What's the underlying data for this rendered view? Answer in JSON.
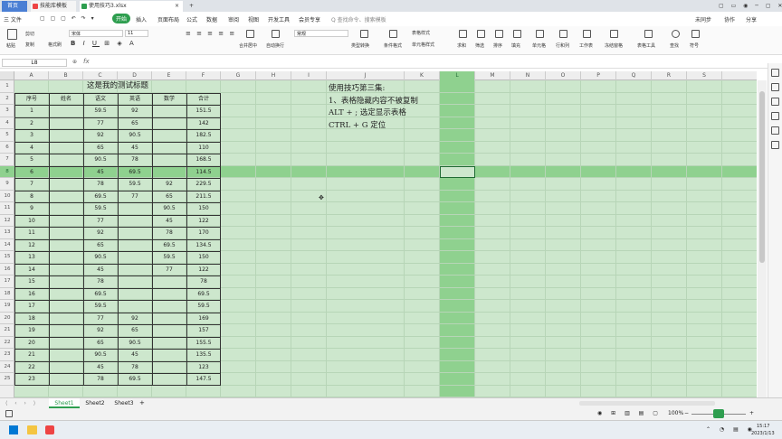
{
  "tabs": {
    "home": "首页",
    "t1": "技能库模板",
    "t2": "使用技巧3.xlsx",
    "add": "+"
  },
  "menu": {
    "file": "三 文件",
    "start": "开始",
    "items": [
      "插入",
      "页面布局",
      "公式",
      "数据",
      "审阅",
      "视图",
      "开发工具",
      "会员专享"
    ],
    "search": "Q 查找命令、搜索模板",
    "sync": "未同步",
    "collab": "协作",
    "share": "分享"
  },
  "ribbon": {
    "paste": "粘贴",
    "cut": "剪切",
    "copy": "复制",
    "format_painter": "格式刷",
    "font_name": "宋体",
    "font_size": "11",
    "merge": "合并居中",
    "wrap": "自动换行",
    "numfmt": "常规",
    "type_convert": "类型转换",
    "cond_fmt": "条件格式",
    "table_style": "表格样式",
    "cell_style": "单元格样式",
    "sum": "求和",
    "filter": "筛选",
    "sort": "排序",
    "fill": "填充",
    "cell": "单元格",
    "rowcol": "行和列",
    "sheet": "工作表",
    "freeze": "冻结窗格",
    "table_tools": "表格工具",
    "find": "查找",
    "symbol": "符号"
  },
  "formula_bar": {
    "name_box": "L8",
    "fx": "fx",
    "content": ""
  },
  "columns": [
    "A",
    "B",
    "C",
    "D",
    "E",
    "F",
    "G",
    "H",
    "I",
    "J",
    "K",
    "L",
    "M",
    "N",
    "O",
    "P",
    "Q",
    "R",
    "S"
  ],
  "rows": [
    "1",
    "2",
    "3",
    "4",
    "5",
    "6",
    "7",
    "8",
    "9",
    "10",
    "11",
    "12",
    "13",
    "14",
    "15",
    "16",
    "17",
    "18",
    "19",
    "20",
    "21",
    "22",
    "23",
    "24",
    "25"
  ],
  "sheet": {
    "title": "这是我的测试标题",
    "headers": [
      "序号",
      "姓名",
      "语文",
      "英语",
      "数学",
      "合计"
    ],
    "data": [
      [
        "1",
        "",
        "59.5",
        "92",
        "",
        "151.5"
      ],
      [
        "2",
        "",
        "77",
        "65",
        "",
        "142"
      ],
      [
        "3",
        "",
        "92",
        "90.5",
        "",
        "182.5"
      ],
      [
        "4",
        "",
        "65",
        "45",
        "",
        "110"
      ],
      [
        "5",
        "",
        "90.5",
        "78",
        "",
        "168.5"
      ],
      [
        "6",
        "",
        "45",
        "69.5",
        "",
        "114.5"
      ],
      [
        "7",
        "",
        "78",
        "59.5",
        "92",
        "229.5"
      ],
      [
        "8",
        "",
        "69.5",
        "77",
        "65",
        "211.5"
      ],
      [
        "9",
        "",
        "59.5",
        "",
        "90.5",
        "150"
      ],
      [
        "10",
        "",
        "77",
        "",
        "45",
        "122"
      ],
      [
        "11",
        "",
        "92",
        "",
        "78",
        "170"
      ],
      [
        "12",
        "",
        "65",
        "",
        "69.5",
        "134.5"
      ],
      [
        "13",
        "",
        "90.5",
        "",
        "59.5",
        "150"
      ],
      [
        "14",
        "",
        "45",
        "",
        "77",
        "122"
      ],
      [
        "15",
        "",
        "78",
        "",
        "",
        "78"
      ],
      [
        "16",
        "",
        "69.5",
        "",
        "",
        "69.5"
      ],
      [
        "17",
        "",
        "59.5",
        "",
        "",
        "59.5"
      ],
      [
        "18",
        "",
        "77",
        "92",
        "",
        "169"
      ],
      [
        "19",
        "",
        "92",
        "65",
        "",
        "157"
      ],
      [
        "20",
        "",
        "65",
        "90.5",
        "",
        "155.5"
      ],
      [
        "21",
        "",
        "90.5",
        "45",
        "",
        "135.5"
      ],
      [
        "22",
        "",
        "45",
        "78",
        "",
        "123"
      ],
      [
        "23",
        "",
        "78",
        "69.5",
        "",
        "147.5"
      ]
    ],
    "notes": [
      "使用技巧第三集:",
      "1、表格隐藏内容不被复制",
      "ALT + ; 选定显示表格",
      "CTRL + G 定位"
    ]
  },
  "sheet_tabs": [
    "Sheet1",
    "Sheet2",
    "Sheet3"
  ],
  "status": {
    "zoom": "100%",
    "time": "15:17",
    "date": "2023/1/13"
  },
  "colors": {
    "grid_bg": "#cde7cd",
    "highlight": "#8fd18f",
    "accent": "#2e9e4f"
  }
}
